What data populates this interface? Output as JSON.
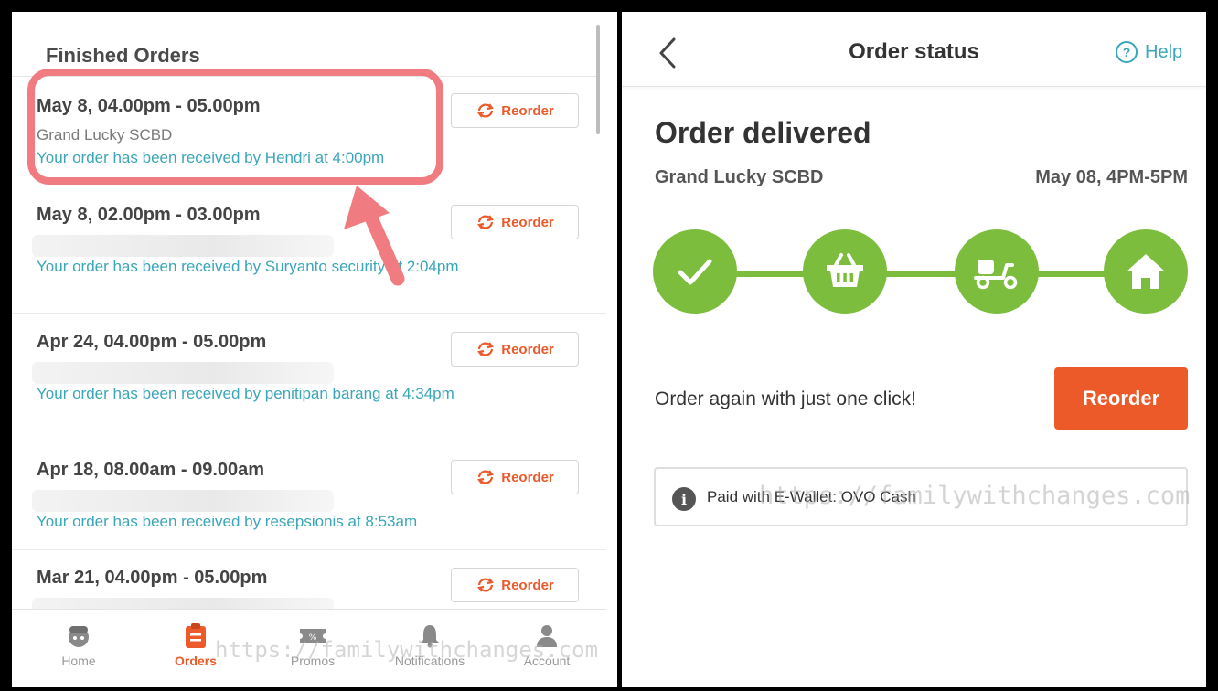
{
  "left": {
    "section_title": "Finished Orders",
    "reorder_label": "Reorder",
    "orders": [
      {
        "date": "May 8, 04.00pm - 05.00pm",
        "store": "Grand Lucky SCBD",
        "status": "Your order has been received by Hendri  at 4:00pm"
      },
      {
        "date": "May 8, 02.00pm - 03.00pm",
        "store": "",
        "status": "Your order has been received by Suryanto security  at 2:04pm"
      },
      {
        "date": "Apr 24, 04.00pm - 05.00pm",
        "store": "",
        "status": "Your order has been received by penitipan barang at 4:34pm"
      },
      {
        "date": "Apr 18, 08.00am - 09.00am",
        "store": "",
        "status": "Your order has been received by resepsionis  at 8:53am"
      },
      {
        "date": "Mar 21, 04.00pm - 05.00pm",
        "store": "",
        "status": ""
      }
    ],
    "tabs": [
      {
        "label": "Home",
        "icon": "home-face-icon"
      },
      {
        "label": "Orders",
        "icon": "clipboard-icon",
        "active": true
      },
      {
        "label": "Promos",
        "icon": "ticket-icon"
      },
      {
        "label": "Notifications",
        "icon": "bell-icon"
      },
      {
        "label": "Account",
        "icon": "person-icon"
      }
    ],
    "watermark": "https://familywithchanges.com"
  },
  "right": {
    "header_title": "Order status",
    "help_label": "Help",
    "status_title": "Order delivered",
    "store": "Grand Lucky SCBD",
    "time_window": "May 08, 4PM-5PM",
    "steps": [
      "check-icon",
      "basket-icon",
      "scooter-icon",
      "house-icon"
    ],
    "again_text": "Order again with just one click!",
    "reorder_button": "Reorder",
    "paid_text": "Paid with E-Wallet: OVO Cash",
    "watermark": "https://familywithchanges.com"
  },
  "colors": {
    "accent_orange": "#ec5a2a",
    "link_teal": "#3aa6b9",
    "progress_green": "#7cbd3d",
    "highlight_pink": "#f07b80"
  }
}
